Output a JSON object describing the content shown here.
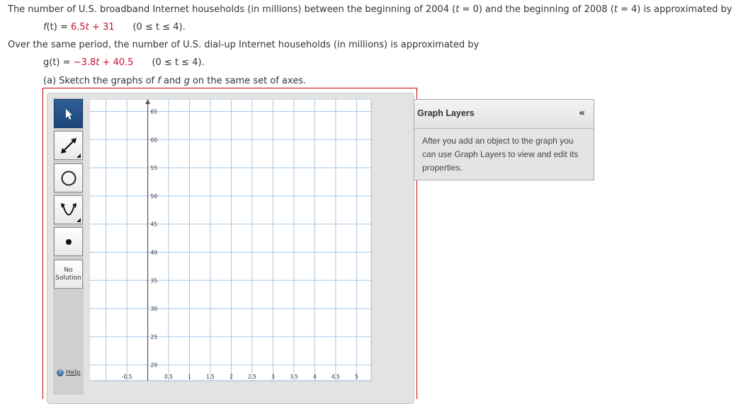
{
  "problem": {
    "intro1_a": "The number of U.S. broadband Internet households (in millions) between the beginning of 2004 (",
    "var_t": "t",
    "intro1_b": " = 0) and the beginning of 2008 (",
    "intro1_c": " = 4) is approximated by",
    "f_lhs_a": "f",
    "f_lhs_b": "(t) = ",
    "f_rhs_a": "6.5",
    "f_rhs_b": "t",
    "f_rhs_c": " + 31",
    "f_domain": "(0 ≤ t ≤ 4).",
    "intro2": "Over the same period, the number of U.S. dial-up Internet households (in millions) is approximated by",
    "g_lhs": "g(t) = ",
    "g_rhs_a": "−3.8",
    "g_rhs_b": "t",
    "g_rhs_c": " + 40.5",
    "g_domain": "(0 ≤ t ≤ 4).",
    "part_a_1": "(a) Sketch the graphs of ",
    "part_a_f": "f",
    "part_a_2": " and ",
    "part_a_g": "g",
    "part_a_3": " on the same set of axes."
  },
  "toolbar": {
    "no_solution": [
      "No",
      "Solution"
    ],
    "help_label": "Help",
    "help_glyph": "?"
  },
  "graph": {
    "x_ticks": [
      "-0.5",
      "0.5",
      "1",
      "1.5",
      "2",
      "2.5",
      "3",
      "3.5",
      "4",
      "4.5",
      "5"
    ],
    "y_ticks": [
      "65",
      "60",
      "55",
      "50",
      "45",
      "40",
      "35",
      "30",
      "25",
      "20"
    ],
    "grid_color": "#a9c7e6",
    "axis_color": "#555555"
  },
  "layers": {
    "title": "Graph Layers",
    "collapse_glyph": "«",
    "message": "After you add an object to the graph you can use Graph Layers to view and edit its properties."
  }
}
